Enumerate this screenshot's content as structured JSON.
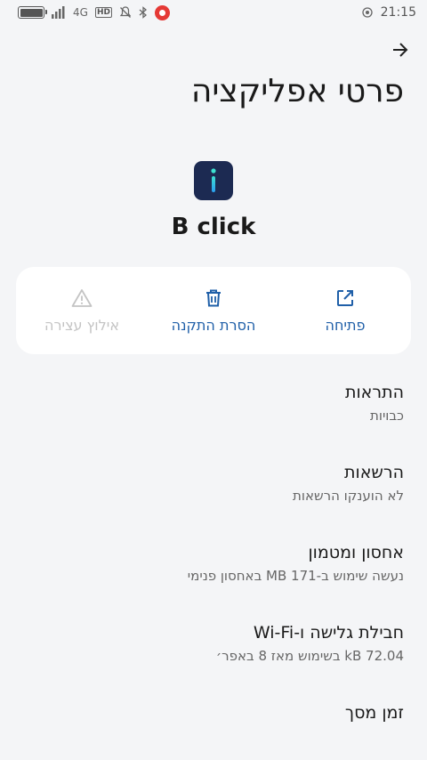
{
  "status_bar": {
    "time": "21:15",
    "network_label": "4G",
    "hd_label": "HD"
  },
  "header": {
    "title": "פרטי אפליקציה"
  },
  "app": {
    "name": "B click",
    "icon_color": "#1c2a52",
    "icon_glyph_color": "#2ad0c8"
  },
  "actions": [
    {
      "label": "פתיחה",
      "icon": "open-external-icon",
      "enabled": true
    },
    {
      "label": "הסרת התקנה",
      "icon": "trash-icon",
      "enabled": true
    },
    {
      "label": "אילוץ עצירה",
      "icon": "warning-icon",
      "enabled": false
    }
  ],
  "settings": [
    {
      "title": "התראות",
      "subtitle": "כבויות"
    },
    {
      "title": "הרשאות",
      "subtitle": "לא הוענקו הרשאות"
    },
    {
      "title": "אחסון ומטמון",
      "subtitle": "נעשה שימוש ב-‏171 MB באחסון פנימי"
    },
    {
      "title": "חבילת גלישה ו-Wi-Fi",
      "subtitle": "‏72.04 kB בשימוש מאז 8 באפר׳"
    },
    {
      "title": "זמן מסך",
      "subtitle": ""
    }
  ],
  "colors": {
    "accent": "#1f5fa8",
    "background": "#f4f5f7",
    "card": "#ffffff",
    "disabled": "#c4c4c4"
  }
}
